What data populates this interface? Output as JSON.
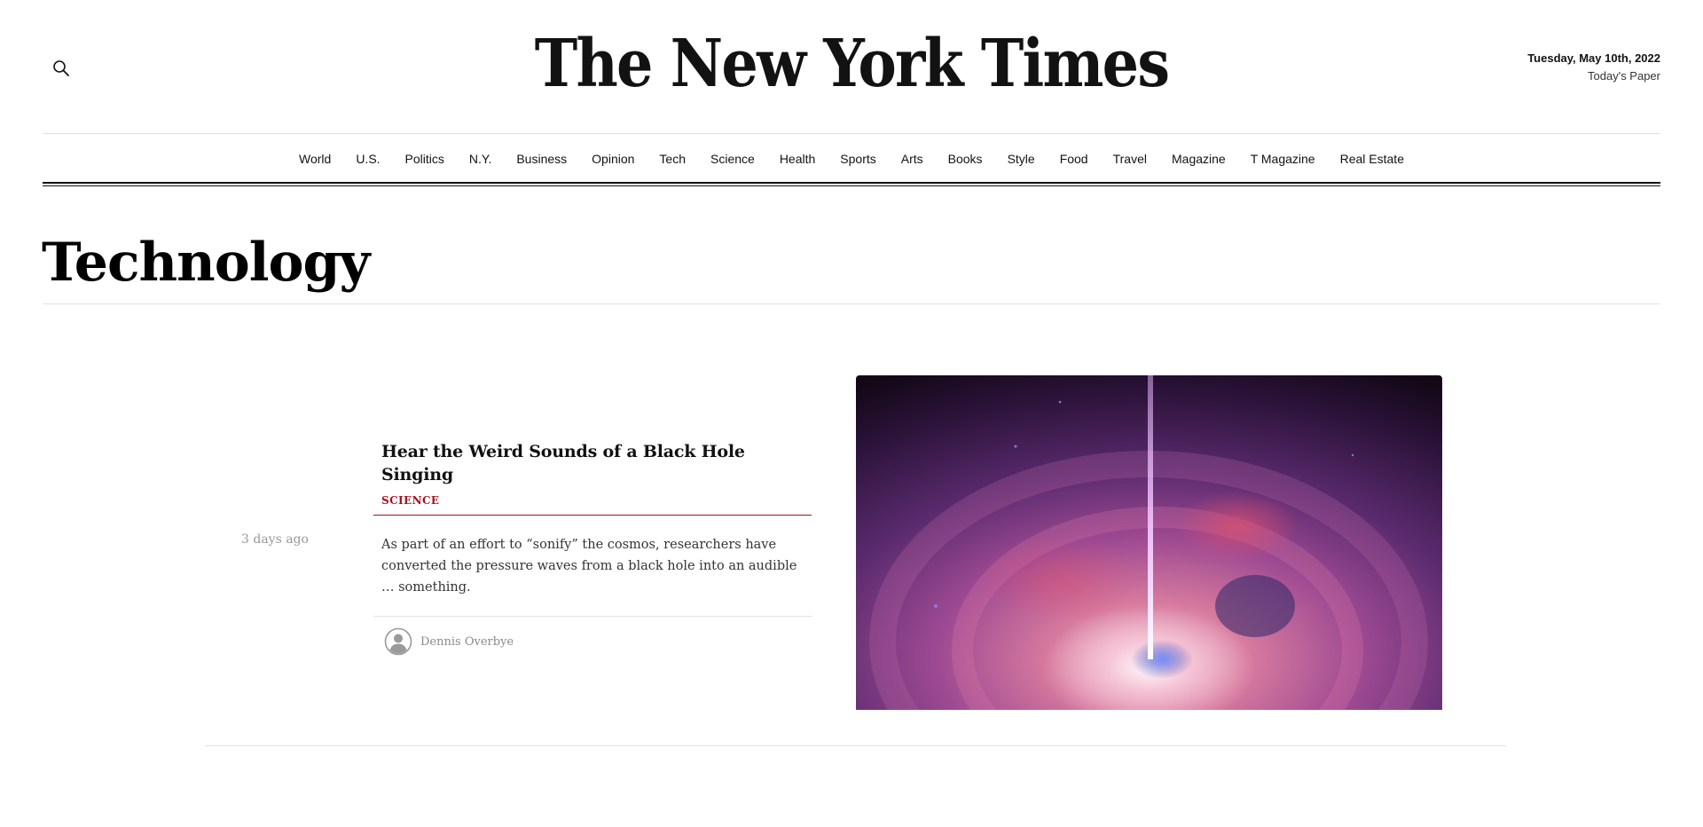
{
  "header": {
    "search_icon": "search-icon",
    "logo_text": "The New York Times",
    "date": "Tuesday, May 10th, 2022",
    "todays_paper": "Today's Paper"
  },
  "nav": {
    "items": [
      {
        "label": "World"
      },
      {
        "label": "U.S."
      },
      {
        "label": "Politics"
      },
      {
        "label": "N.Y."
      },
      {
        "label": "Business"
      },
      {
        "label": "Opinion"
      },
      {
        "label": "Tech"
      },
      {
        "label": "Science"
      },
      {
        "label": "Health"
      },
      {
        "label": "Sports"
      },
      {
        "label": "Arts"
      },
      {
        "label": "Books"
      },
      {
        "label": "Style"
      },
      {
        "label": "Food"
      },
      {
        "label": "Travel"
      },
      {
        "label": "Magazine"
      },
      {
        "label": "T Magazine"
      },
      {
        "label": "Real Estate"
      }
    ]
  },
  "section": {
    "title": "Technology"
  },
  "story": {
    "timestamp": "3 days ago",
    "headline": "Hear the Weird Sounds of a Black Hole Singing",
    "kicker": "SCIENCE",
    "summary": "As part of an effort to “sonify” the cosmos, researchers have converted the pressure waves from a black hole into an audible … something.",
    "author": "Dennis Overbye",
    "avatar_icon": "user-avatar-icon"
  },
  "colors": {
    "kicker": "#a6101f",
    "text": "#121212",
    "muted": "#999999",
    "rule": "#e2e2e2"
  }
}
